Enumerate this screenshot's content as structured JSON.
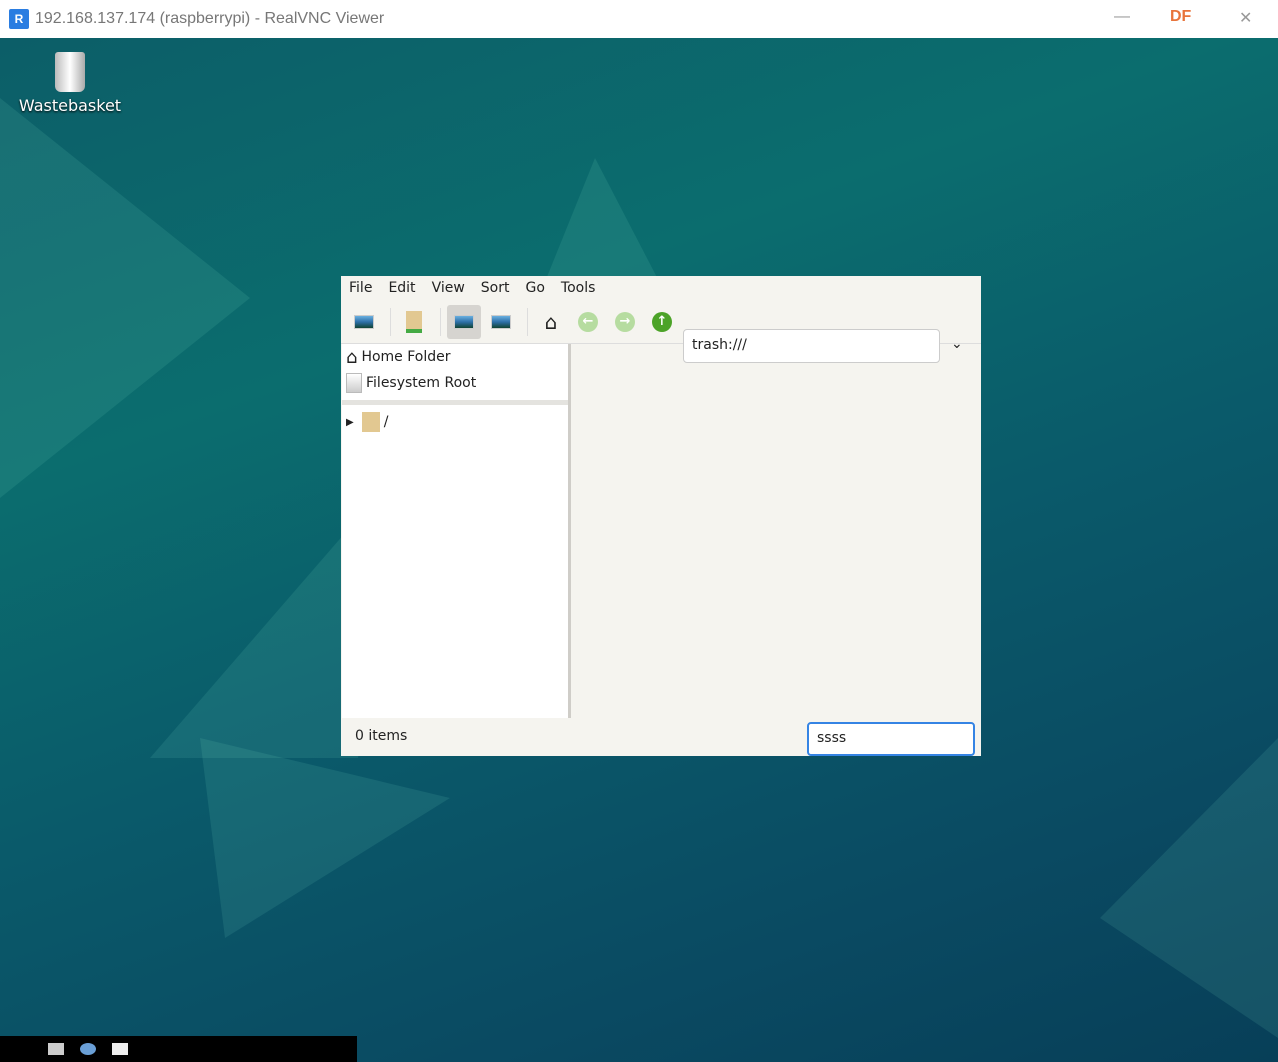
{
  "window": {
    "title": "192.168.137.174 (raspberrypi) - RealVNC Viewer",
    "logo": "R",
    "brand_badge": "DF"
  },
  "desktop": {
    "icons": [
      {
        "label": "Wastebasket",
        "icon": "trash-icon"
      }
    ]
  },
  "file_manager": {
    "menu": [
      "File",
      "Edit",
      "View",
      "Sort",
      "Go",
      "Tools"
    ],
    "path": "trash:///",
    "places": [
      {
        "label": "Home Folder",
        "icon": "home-icon"
      },
      {
        "label": "Filesystem Root",
        "icon": "drive-icon"
      }
    ],
    "tree": [
      {
        "label": "/",
        "icon": "folder-icon",
        "expanded": false
      }
    ],
    "status": "0 items",
    "filter_value": "ssss"
  }
}
